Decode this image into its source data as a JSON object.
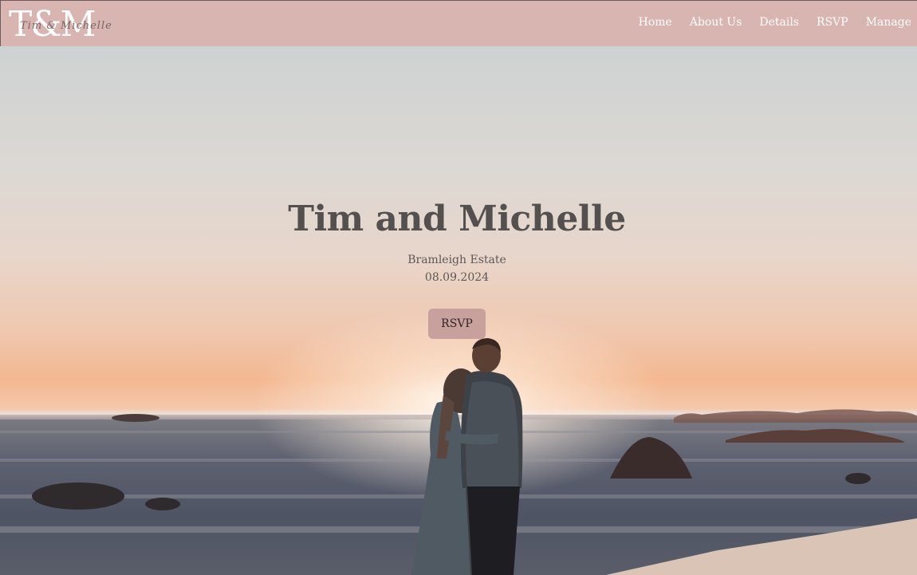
{
  "nav": {
    "logo": "T&M",
    "logo_script": "Tim & Michelle",
    "links": [
      "Home",
      "About Us",
      "Details",
      "RSVP",
      "Manage"
    ]
  },
  "hero": {
    "title": "Tim and Michelle",
    "venue": "Bramleigh Estate",
    "date": "08.09.2024",
    "rsvp_label": "RSVP"
  },
  "colors": {
    "navbar": "#d8b5b1",
    "rsvp_button": "#c8a09c",
    "title_text": "#545050"
  }
}
